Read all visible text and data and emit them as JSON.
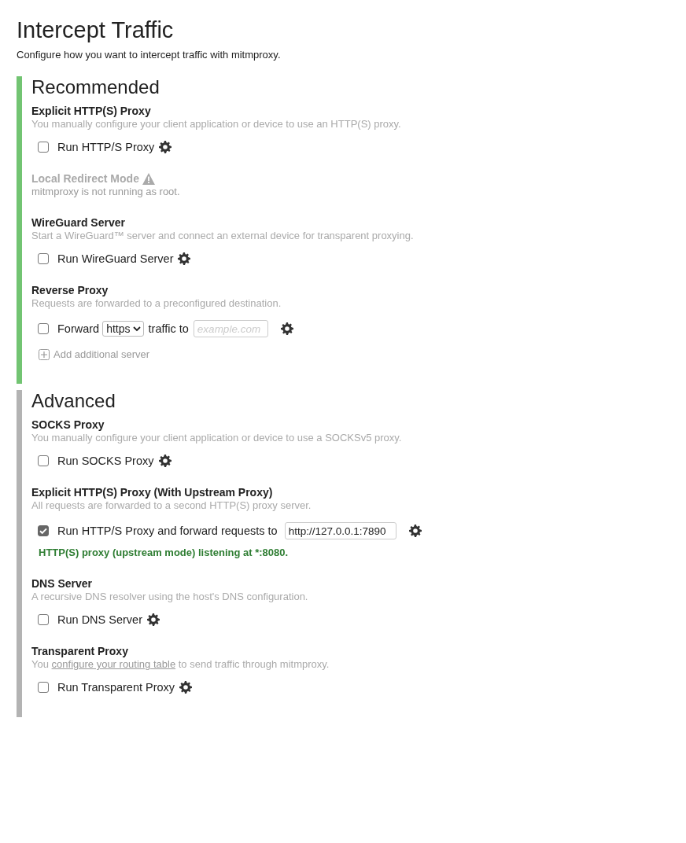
{
  "page": {
    "title": "Intercept Traffic",
    "subtitle": "Configure how you want to intercept traffic with mitmproxy."
  },
  "groups": [
    {
      "heading": "Recommended",
      "color": "#72c472",
      "modes": [
        {
          "kind": "simple",
          "title": "Explicit HTTP(S) Proxy",
          "description": "You manually configure your client application or device to use an HTTP(S) proxy.",
          "checked": false,
          "label": "Run HTTP/S Proxy"
        },
        {
          "kind": "unavailable",
          "title": "Local Redirect Mode",
          "description": "mitmproxy is not running as root."
        },
        {
          "kind": "simple",
          "title": "WireGuard Server",
          "description": "Start a WireGuard™ server and connect an external device for transparent proxying.",
          "checked": false,
          "label": "Run WireGuard Server"
        },
        {
          "kind": "reverse",
          "title": "Reverse Proxy",
          "description": "Requests are forwarded to a preconfigured destination.",
          "checked": false,
          "label": "Forward",
          "protocol": "https",
          "label_after": "traffic to",
          "placeholder": "example.com",
          "add_label": "Add additional server"
        }
      ]
    },
    {
      "heading": "Advanced",
      "color": "#b3b3b3",
      "modes": [
        {
          "kind": "simple",
          "title": "SOCKS Proxy",
          "description": "You manually configure your client application or device to use a SOCKSv5 proxy.",
          "checked": false,
          "label": "Run SOCKS Proxy"
        },
        {
          "kind": "upstream",
          "title": "Explicit HTTP(S) Proxy (With Upstream Proxy)",
          "description": "All requests are forwarded to a second HTTP(S) proxy server.",
          "checked": true,
          "label": "Run HTTP/S Proxy and forward requests to",
          "value": "http://127.0.0.1:7890",
          "status": "HTTP(S) proxy (upstream mode) listening at *:8080."
        },
        {
          "kind": "simple",
          "title": "DNS Server",
          "description": "A recursive DNS resolver using the host's DNS configuration.",
          "checked": false,
          "label": "Run DNS Server"
        },
        {
          "kind": "simple",
          "title": "Transparent Proxy",
          "description": "You ",
          "description_link": "configure your routing table",
          "description_after": " to send traffic through mitmproxy.",
          "checked": false,
          "label": "Run Transparent Proxy"
        }
      ]
    }
  ]
}
